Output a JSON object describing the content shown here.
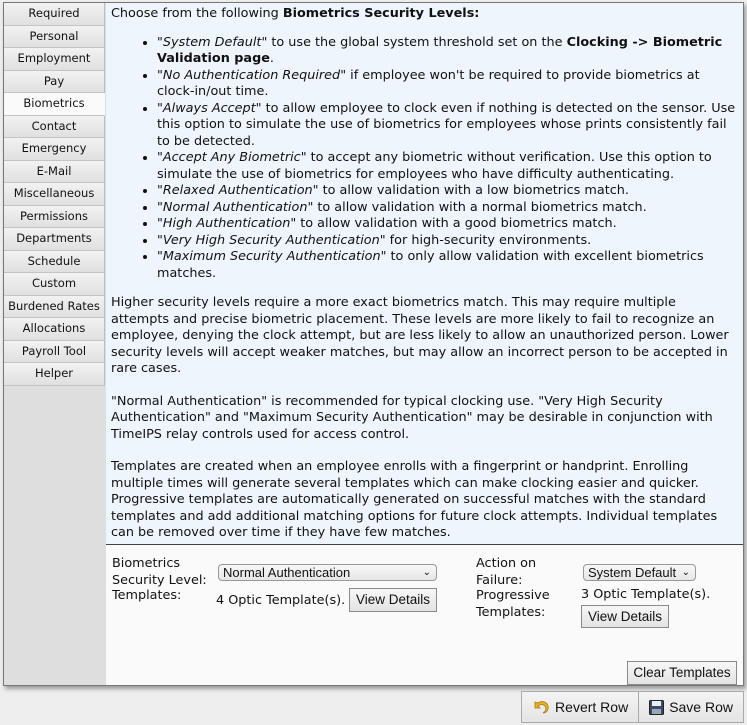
{
  "sidebar": {
    "tabs": [
      {
        "label": "Required",
        "active": false
      },
      {
        "label": "Personal",
        "active": false
      },
      {
        "label": "Employment",
        "active": false
      },
      {
        "label": "Pay",
        "active": false
      },
      {
        "label": "Biometrics",
        "active": true
      },
      {
        "label": "Contact",
        "active": false
      },
      {
        "label": "Emergency",
        "active": false
      },
      {
        "label": "E-Mail",
        "active": false
      },
      {
        "label": "Miscellaneous",
        "active": false
      },
      {
        "label": "Permissions",
        "active": false
      },
      {
        "label": "Departments",
        "active": false
      },
      {
        "label": "Schedule",
        "active": false
      },
      {
        "label": "Custom",
        "active": false
      },
      {
        "label": "Burdened Rates",
        "active": false
      },
      {
        "label": "Allocations",
        "active": false
      },
      {
        "label": "Payroll Tool",
        "active": false
      },
      {
        "label": "Helper",
        "active": false
      }
    ]
  },
  "help": {
    "intro_prefix": "Choose from the following ",
    "intro_bold": "Biometrics Security Levels:",
    "levels": [
      {
        "name": "System Default",
        "text": "\" to use the global system threshold set on the ",
        "bold": "Clocking -> Biometric Validation page",
        "suffix": "."
      },
      {
        "name": "No Authentication Required",
        "text": "\" if employee won't be required to provide biometrics at clock-in/out time.",
        "bold": "",
        "suffix": ""
      },
      {
        "name": "Always Accept",
        "text": "\" to allow employee to clock even if nothing is detected on the sensor. Use this option to simulate the use of biometrics for employees whose prints consistently fail to be detected.",
        "bold": "",
        "suffix": ""
      },
      {
        "name": "Accept Any Biometric",
        "text": "\" to accept any biometric without verification. Use this option to simulate the use of biometrics for employees who have difficulty authenticating.",
        "bold": "",
        "suffix": ""
      },
      {
        "name": "Relaxed Authentication",
        "text": "\" to allow validation with a low biometrics match.",
        "bold": "",
        "suffix": ""
      },
      {
        "name": "Normal Authentication",
        "text": "\" to allow validation with a normal biometrics match.",
        "bold": "",
        "suffix": ""
      },
      {
        "name": "High Authentication",
        "text": "\" to allow validation with a good biometrics match.",
        "bold": "",
        "suffix": ""
      },
      {
        "name": "Very High Security Authentication",
        "text": "\" for high-security environments.",
        "bold": "",
        "suffix": ""
      },
      {
        "name": "Maximum Security Authentication",
        "text": "\" to only allow validation with excellent biometrics matches.",
        "bold": "",
        "suffix": ""
      }
    ],
    "paragraphs": [
      "Higher security levels require a more exact biometrics match. This may require multiple attempts and precise biometric placement. These levels are more likely to fail to recognize an employee, denying the clock attempt, but are less likely to allow an unauthorized person. Lower security levels will accept weaker matches, but may allow an incorrect person to be accepted in rare cases.",
      "\"Normal Authentication\" is recommended for typical clocking use. \"Very High Security Authentication\" and \"Maximum Security Authentication\" may be desirable in conjunction with TimeIPS relay controls used for access control.",
      "Templates are created when an employee enrolls with a fingerprint or handprint. Enrolling multiple times will generate several templates which can make clocking easier and quicker. Progressive templates are automatically generated on successful matches with the standard templates and add additional matching options for future clock attempts. Individual templates can be removed over time if they have few matches."
    ]
  },
  "form": {
    "security_level_label_1": "Biometrics",
    "security_level_label_2": "Security Level:",
    "security_level_value": "Normal Authentication",
    "templates_label": "Templates:",
    "templates_value": "4 Optic Template(s).",
    "templates_view_button": "View Details",
    "action_label_1": "Action on",
    "action_label_2": "Failure:",
    "action_value": "System Default",
    "progressive_label_1": "Progressive",
    "progressive_label_2": "Templates:",
    "progressive_value": "3 Optic Template(s).",
    "progressive_view_button": "View Details",
    "clear_button": "Clear Templates"
  },
  "footer": {
    "revert_label": "Revert Row",
    "save_label": "Save Row"
  }
}
